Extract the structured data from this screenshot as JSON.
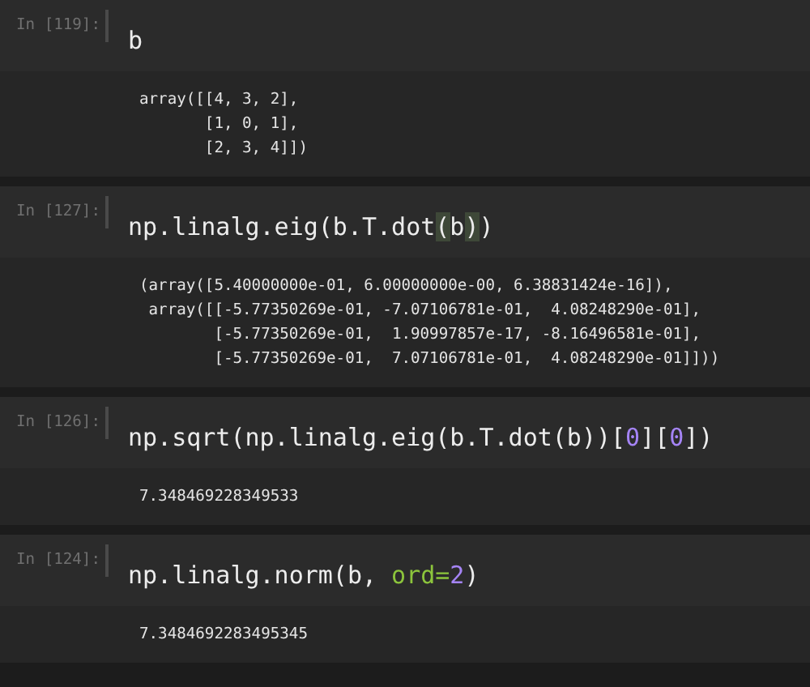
{
  "cells": [
    {
      "prompt": "In [119]:",
      "code": [
        {
          "kind": "plain",
          "text": "b"
        }
      ],
      "output": [
        "array([[4, 3, 2],",
        "       [1, 0, 1],",
        "       [2, 3, 4]])"
      ]
    },
    {
      "prompt": "In [127]:",
      "code": [
        {
          "kind": "plain",
          "text": "np.linalg.eig(b.T.dot"
        },
        {
          "kind": "match",
          "text": "("
        },
        {
          "kind": "plain",
          "text": "b"
        },
        {
          "kind": "match",
          "text": ")"
        },
        {
          "kind": "plain",
          "text": ")"
        }
      ],
      "output": [
        "(array([5.40000000e-01, 6.00000000e-00, 6.38831424e-16]),",
        " array([[-5.77350269e-01, -7.07106781e-01,  4.08248290e-01],",
        "        [-5.77350269e-01,  1.90997857e-17, -8.16496581e-01],",
        "        [-5.77350269e-01,  7.07106781e-01,  4.08248290e-01]]))"
      ]
    },
    {
      "prompt": "In [126]:",
      "code": [
        {
          "kind": "plain",
          "text": "np.sqrt(np.linalg.eig(b.T.dot(b))["
        },
        {
          "kind": "number",
          "text": "0"
        },
        {
          "kind": "plain",
          "text": "]["
        },
        {
          "kind": "number",
          "text": "0"
        },
        {
          "kind": "plain",
          "text": "])"
        }
      ],
      "output": [
        "7.348469228349533"
      ]
    },
    {
      "prompt": "In [124]:",
      "code": [
        {
          "kind": "plain",
          "text": "np.linalg.norm(b, "
        },
        {
          "kind": "keyword",
          "text": "ord="
        },
        {
          "kind": "number",
          "text": "2"
        },
        {
          "kind": "plain",
          "text": ")"
        }
      ],
      "output": [
        "7.3484692283495345"
      ]
    }
  ]
}
